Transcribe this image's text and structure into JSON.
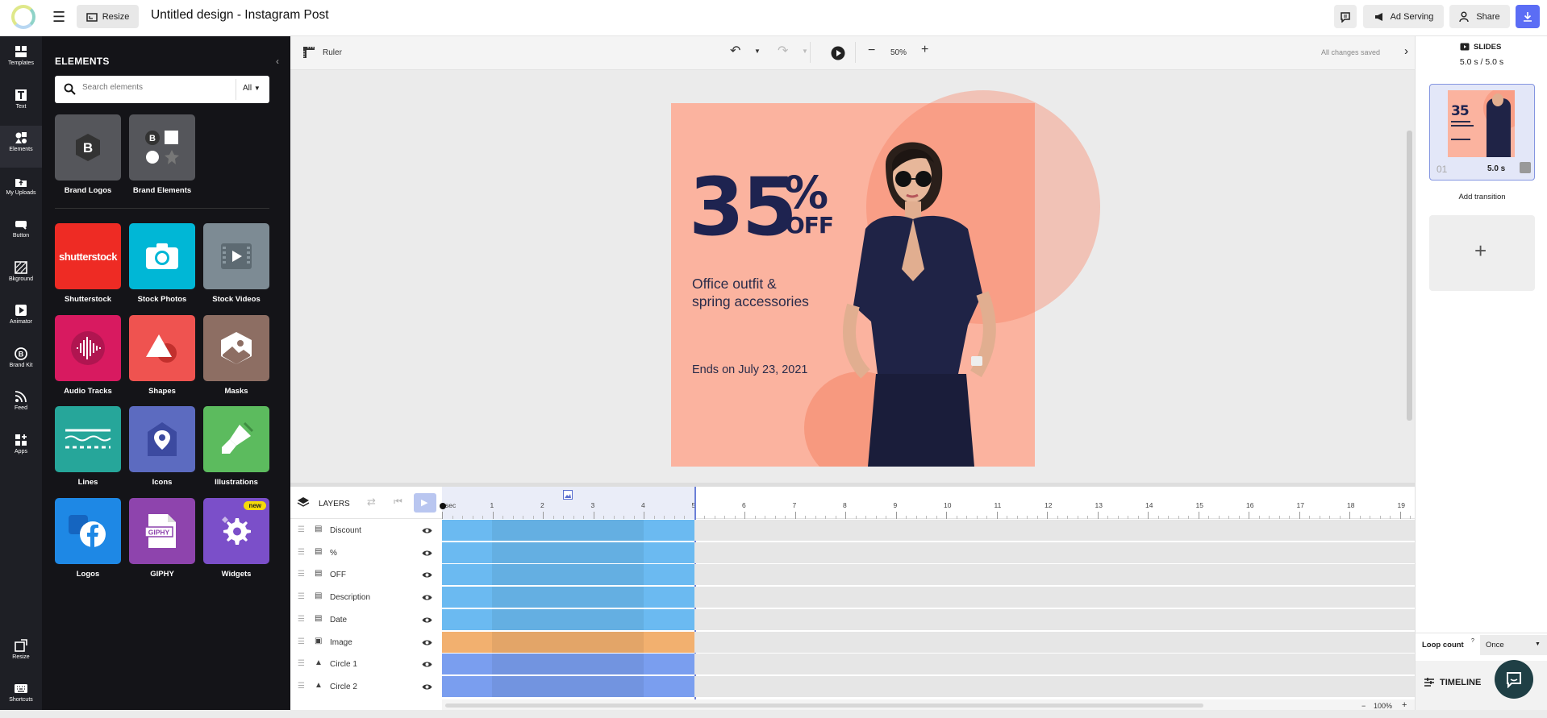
{
  "header": {
    "resize_label": "Resize",
    "title": "Untitled design - Instagram Post",
    "ad_serving_label": "Ad Serving",
    "share_label": "Share"
  },
  "rail": {
    "items": [
      {
        "label": "Templates",
        "icon": "templates-icon"
      },
      {
        "label": "Text",
        "icon": "text-icon"
      },
      {
        "label": "Elements",
        "icon": "elements-icon"
      },
      {
        "label": "My Uploads",
        "icon": "uploads-icon"
      },
      {
        "label": "Button",
        "icon": "button-icon"
      },
      {
        "label": "Bkground",
        "icon": "background-icon"
      },
      {
        "label": "Animator",
        "icon": "animator-icon"
      },
      {
        "label": "Brand Kit",
        "icon": "brand-kit-icon"
      },
      {
        "label": "Feed",
        "icon": "feed-icon"
      },
      {
        "label": "Apps",
        "icon": "apps-icon"
      }
    ],
    "bottom": [
      {
        "label": "Resize",
        "icon": "resize-icon"
      },
      {
        "label": "Shortcuts",
        "icon": "keyboard-icon"
      }
    ]
  },
  "elements_panel": {
    "title": "ELEMENTS",
    "search_placeholder": "Search elements",
    "filter_value": "All",
    "brand_tiles": [
      {
        "label": "Brand Logos",
        "color": "#55565b"
      },
      {
        "label": "Brand Elements",
        "color": "#55565b"
      }
    ],
    "tiles": [
      {
        "label": "Shutterstock",
        "color": "#ee2b24"
      },
      {
        "label": "Stock Photos",
        "color": "#00b7d6"
      },
      {
        "label": "Stock Videos",
        "color": "#7d8b94"
      },
      {
        "label": "Audio Tracks",
        "color": "#d81a60"
      },
      {
        "label": "Shapes",
        "color": "#ef5350"
      },
      {
        "label": "Masks",
        "color": "#8d6e63"
      },
      {
        "label": "Lines",
        "color": "#26a69a"
      },
      {
        "label": "Icons",
        "color": "#5c6bc0"
      },
      {
        "label": "Illustrations",
        "color": "#5cbb5e"
      },
      {
        "label": "Logos",
        "color": "#1e88e5"
      },
      {
        "label": "GIPHY",
        "color": "#8e44ad"
      },
      {
        "label": "Widgets",
        "color": "#7b4fc9"
      }
    ],
    "shutterstock_word": "shutterstock",
    "giphy_word": "GIPHY",
    "new_badge": "new"
  },
  "canvas_bar": {
    "ruler_label": "Ruler",
    "zoom": "50%",
    "save_status": "All changes saved"
  },
  "post": {
    "discount": "35",
    "percent": "%",
    "off": "OFF",
    "description_line1": "Office outfit &",
    "description_line2": "spring accessories",
    "date": "Ends on July 23, 2021",
    "background_color": "#fbb39f"
  },
  "timeline": {
    "layers_label": "LAYERS",
    "ticks": [
      "sec",
      "1",
      "2",
      "3",
      "4",
      "5",
      "6",
      "7",
      "8",
      "9",
      "10",
      "11",
      "12",
      "13",
      "14",
      "15",
      "16",
      "17",
      "18",
      "19"
    ],
    "layers": [
      {
        "name": "Discount",
        "type": "text",
        "color": "#6bbaf1"
      },
      {
        "name": "%",
        "type": "text",
        "color": "#6bbaf1"
      },
      {
        "name": "OFF",
        "type": "text",
        "color": "#6bbaf1"
      },
      {
        "name": "Description",
        "type": "text",
        "color": "#6bbaf1"
      },
      {
        "name": "Date",
        "type": "text",
        "color": "#6bbaf1"
      },
      {
        "name": "Image",
        "type": "image",
        "color": "#f2b06f"
      },
      {
        "name": "Circle 1",
        "type": "shape",
        "color": "#7a9eef"
      },
      {
        "name": "Circle 2",
        "type": "shape",
        "color": "#7a9eef"
      }
    ],
    "zoom": "100%"
  },
  "slides_panel": {
    "title": "SLIDES",
    "duration": "5.0 s / 5.0 s",
    "slide_number": "01",
    "slide_duration": "5.0 s",
    "add_transition": "Add transition",
    "loop_label": "Loop count",
    "loop_help": "?",
    "loop_value": "Once",
    "timeline_label": "TIMELINE"
  }
}
